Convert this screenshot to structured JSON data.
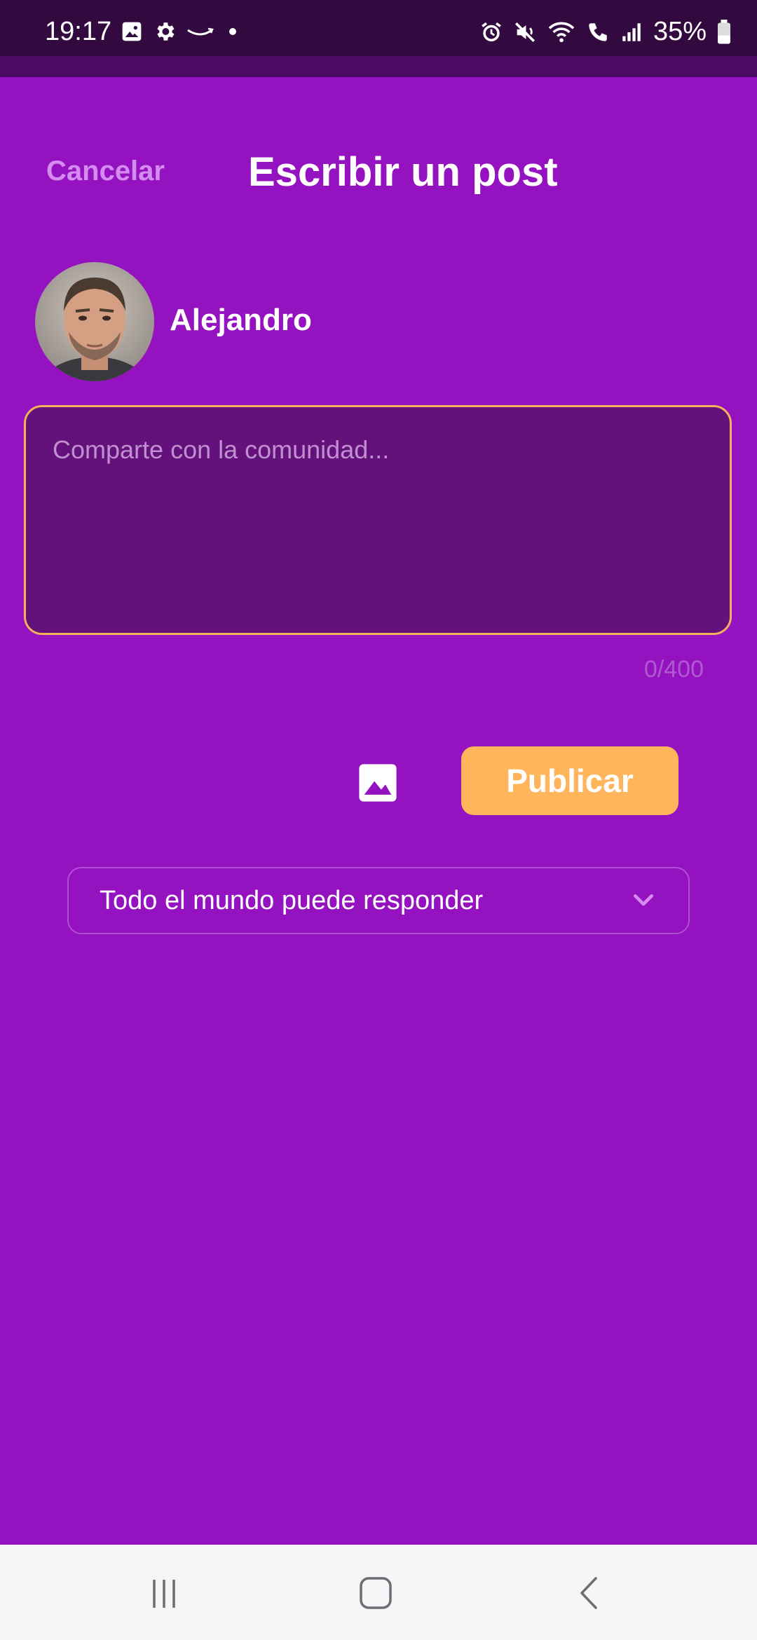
{
  "status_bar": {
    "time": "19:17",
    "battery": "35%",
    "left_icons": [
      "image-notification-icon",
      "settings-notification-icon",
      "amazon-notification-icon",
      "dot-icon"
    ],
    "right_icons": [
      "alarm-icon",
      "mute-icon",
      "wifi-icon",
      "wifi-calling-icon",
      "signal-icon",
      "battery-icon"
    ]
  },
  "header": {
    "cancel_label": "Cancelar",
    "title": "Escribir un post"
  },
  "user": {
    "name": "Alejandro"
  },
  "composer": {
    "placeholder": "Comparte con la comunidad...",
    "value": "",
    "counter": "0/400",
    "border_color": "#f2b15a"
  },
  "actions": {
    "image_icon": "image-icon",
    "publish_label": "Publicar",
    "publish_color": "#ffb55c"
  },
  "reply_setting": {
    "selected": "Todo el mundo puede responder"
  },
  "colors": {
    "background": "#9512c0",
    "accent": "#ffb55c"
  }
}
